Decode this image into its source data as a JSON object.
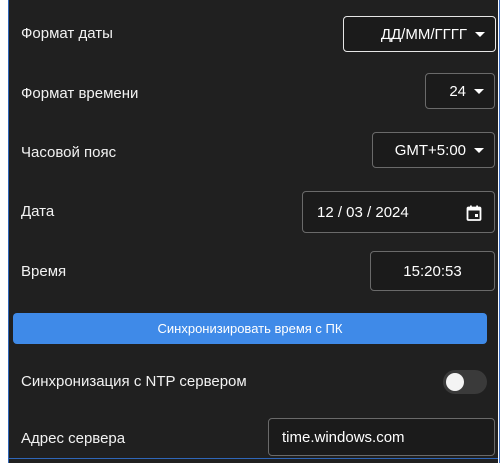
{
  "settings": {
    "date_format": {
      "label": "Формат даты",
      "value": "ДД/ММ/ГГГГ"
    },
    "time_format": {
      "label": "Формат времени",
      "value": "24"
    },
    "timezone": {
      "label": "Часовой пояс",
      "value": "GMT+5:00"
    },
    "date": {
      "label": "Дата",
      "value": "12 / 03 / 2024"
    },
    "time": {
      "label": "Время",
      "value": "15:20:53"
    },
    "sync_button": "Синхронизировать время с ПК",
    "ntp_sync": {
      "label": "Синхронизация с NTP сервером",
      "enabled": false
    },
    "server_address": {
      "label": "Адрес сервера",
      "value": "time.windows.com"
    }
  },
  "colors": {
    "panel_bg": "#202020",
    "accent_button": "#3f8ae8",
    "frame_blue": "#2f66b8"
  },
  "icons": {
    "dropdown": "chevron-down-icon",
    "calendar": "calendar-icon"
  }
}
